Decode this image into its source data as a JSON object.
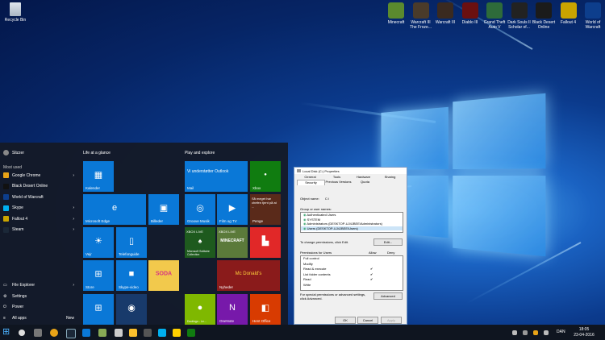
{
  "desktop": {
    "recycle_bin": "Recycle Bin",
    "icons": [
      {
        "label": "Minecraft",
        "color": "#5b8a2e"
      },
      {
        "label": "Warcraft III The Froze...",
        "color": "#4a3b2a"
      },
      {
        "label": "Warcraft III",
        "color": "#3a2a20"
      },
      {
        "label": "Diablo III",
        "color": "#6b1010"
      },
      {
        "label": "Grand Theft Auto V",
        "color": "#2e6b3a"
      },
      {
        "label": "Dark Souls II Scholar of...",
        "color": "#222"
      },
      {
        "label": "Black Desert Online",
        "color": "#1b1b1b"
      },
      {
        "label": "Fallout 4",
        "color": "#c9a400"
      },
      {
        "label": "World of Warcraft",
        "color": "#0d3e8c"
      }
    ]
  },
  "start": {
    "user": "Slizzer",
    "most_used_heading": "Most used",
    "apps": [
      {
        "label": "Google Chrome",
        "color": "#e8a317",
        "arrow": "›"
      },
      {
        "label": "Black Desert Online",
        "color": "#111",
        "arrow": ""
      },
      {
        "label": "World of Warcraft",
        "color": "#0d3e8c",
        "arrow": ""
      },
      {
        "label": "Skype",
        "color": "#00aff0",
        "arrow": "›"
      },
      {
        "label": "Fallout 4",
        "color": "#c9a400",
        "arrow": "›"
      },
      {
        "label": "Steam",
        "color": "#1b2838",
        "arrow": "›"
      }
    ],
    "bottom": [
      {
        "label": "File Explorer",
        "arrow": "›"
      },
      {
        "label": "Settings",
        "arrow": ""
      },
      {
        "label": "Power",
        "arrow": ""
      },
      {
        "label": "All apps",
        "new": "New"
      }
    ],
    "group1": "Life at a glance",
    "group2": "Play and explore",
    "tiles": {
      "kalender": "Kalender",
      "edge": "Microsoft Edge",
      "billeder": "Billeder",
      "vejr": "Vejr",
      "telefon": "Telefonguide",
      "store": "Store",
      "skype_video": "Skype-video",
      "mail": "Mail",
      "mail_text": "Vi understøtter Outlook",
      "groove": "Groove Musik",
      "film": "Film og TV",
      "xbox": "Xbox",
      "solitaire": "Microsoft Solitaire Collection",
      "minecraft": "MINECRAFT",
      "flipboard": "",
      "nyheder": "Nyheder",
      "news_text": "Mc Donald's",
      "duolingo": "Duolingo - Le...",
      "onenote": "OneNote",
      "office": "Hent Office",
      "penge": "Penge",
      "penge_text": "Så meget har chefen tjent på at ...",
      "candy": "SODA",
      "xbox_live": "XBOX LIVE"
    }
  },
  "dialog": {
    "title": "Local Disk (C:) Properties",
    "tabs": [
      "General",
      "Tools",
      "Hardware",
      "Sharing",
      "Security",
      "Previous Versions",
      "Quota"
    ],
    "object_name_label": "Object name:",
    "object_name": "C:\\",
    "group_label": "Group or user names:",
    "users": [
      "Authenticated Users",
      "SYSTEM",
      "Administrators (DESKTOP-UJ4JBEE\\Administrators)",
      "Users (DESKTOP-UJ4JBEE\\Users)"
    ],
    "change_text": "To change permissions, click Edit.",
    "edit": "Edit...",
    "perm_for": "Permissions for Users",
    "allow": "Allow",
    "deny": "Deny",
    "perms": [
      {
        "name": "Full control",
        "allow": ""
      },
      {
        "name": "Modify",
        "allow": ""
      },
      {
        "name": "Read & execute",
        "allow": "✔"
      },
      {
        "name": "List folder contents",
        "allow": "✔"
      },
      {
        "name": "Read",
        "allow": "✔"
      },
      {
        "name": "Write",
        "allow": ""
      }
    ],
    "special_text": "For special permissions or advanced settings, click Advanced.",
    "advanced": "Advanced",
    "ok": "OK",
    "cancel": "Cancel",
    "apply": "Apply"
  },
  "taskbar": {
    "time": "18:05",
    "date": "23-04-2016",
    "lang": "DAN"
  }
}
